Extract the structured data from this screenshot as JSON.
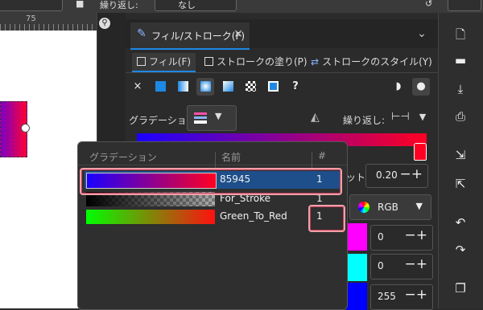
{
  "topbar": {
    "label": "繰り返し:",
    "value": "なし"
  },
  "ruler": {
    "mark": "75"
  },
  "dock": {
    "tab_label": "フィル/ストローク(F)",
    "close": "×",
    "collapse": "⌄"
  },
  "subtabs": {
    "fill": "フィル(F)",
    "stroke_paint": "ストロークの塗り(P)",
    "stroke_style": "ストロークのスタイル(Y)"
  },
  "fill_types": {
    "none": "×",
    "unknown": "?"
  },
  "gradient": {
    "label": "グラデーション:",
    "repeat_label": "繰り返し:",
    "repeat_value": "⊢⊣",
    "offset_label": "ット:",
    "offset_value": "0.20",
    "bar_colors": [
      "#1a00ff",
      "#ff0022"
    ]
  },
  "color": {
    "mode": "RGB",
    "channels": [
      {
        "swatch": "#ff00ff",
        "value": "0"
      },
      {
        "swatch": "#00ffff",
        "value": "0"
      },
      {
        "swatch": "#0000ff",
        "value": "255"
      }
    ]
  },
  "popup": {
    "headers": {
      "gradient": "グラデーション",
      "name": "名前",
      "count": "#"
    },
    "rows": [
      {
        "name": "85945",
        "count": "1",
        "colors": [
          "#1a00ff",
          "#ff0022"
        ],
        "selected": true
      },
      {
        "name": "For_Stroke",
        "count": "1",
        "colors": [
          "#000000",
          "transparent"
        ],
        "selected": false
      },
      {
        "name": "Green_To_Red",
        "count": "1",
        "colors": [
          "#00ff00",
          "#ff1010"
        ],
        "selected": false
      }
    ]
  },
  "rightbar_icons": [
    "new-doc-icon",
    "open-folder-icon",
    "save-icon",
    "print-icon",
    "import-icon",
    "export-icon",
    "undo-icon",
    "redo-icon",
    "copy-icon"
  ]
}
